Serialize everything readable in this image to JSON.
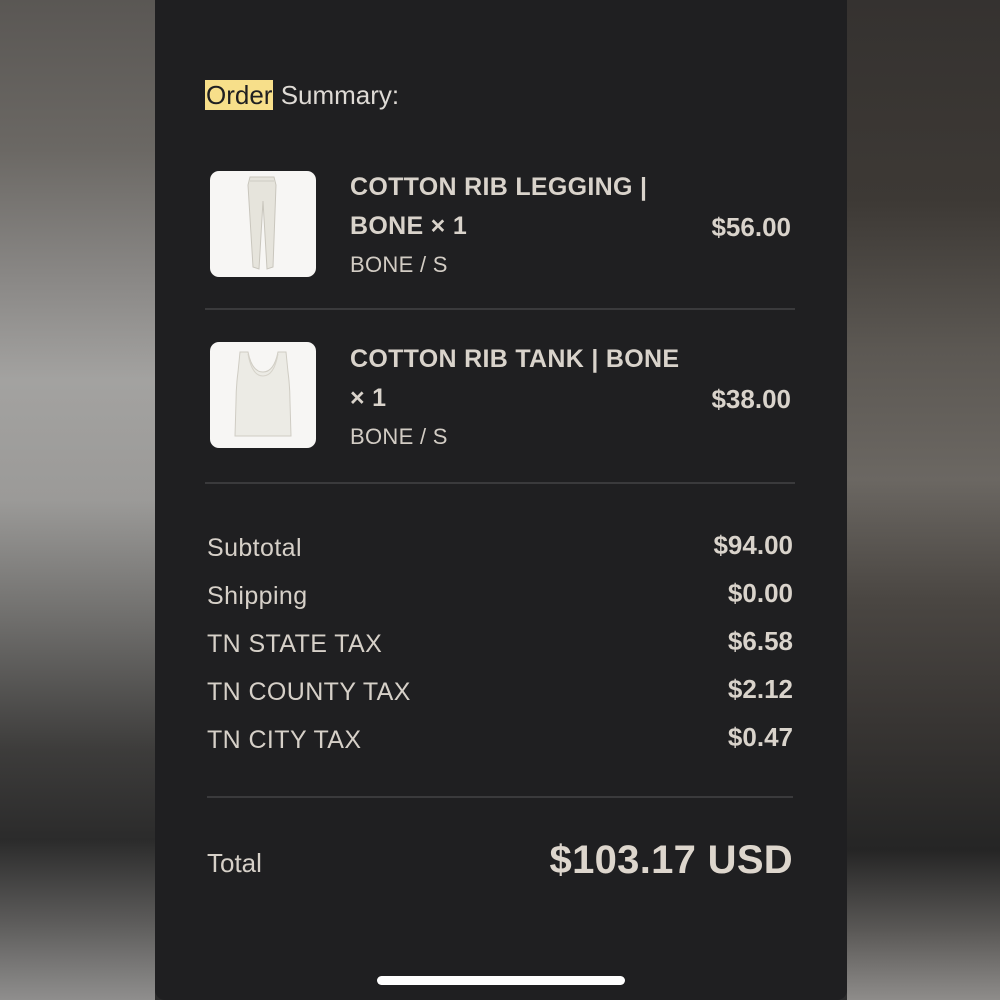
{
  "summary": {
    "heading_highlight": "Order",
    "heading_rest": " Summary:"
  },
  "items": [
    {
      "name": "COTTON RIB LEGGING | BONE × 1",
      "variant": "BONE / S",
      "price": "$56.00",
      "image_icon": "legging-image"
    },
    {
      "name": "COTTON RIB TANK | BONE × 1",
      "variant": "BONE / S",
      "price": "$38.00",
      "image_icon": "tank-top-image"
    }
  ],
  "costs": [
    {
      "label": "Subtotal",
      "value": "$94.00"
    },
    {
      "label": "Shipping",
      "value": "$0.00"
    },
    {
      "label": "TN STATE TAX",
      "value": "$6.58"
    },
    {
      "label": "TN COUNTY TAX",
      "value": "$2.12"
    },
    {
      "label": "TN CITY TAX",
      "value": "$0.47"
    }
  ],
  "total": {
    "label": "Total",
    "value": "$103.17 USD"
  },
  "colors": {
    "background": "#1f1f21",
    "text": "#d9d3cb",
    "highlight": "#f7df8a",
    "divider": "#3a3a3c"
  }
}
